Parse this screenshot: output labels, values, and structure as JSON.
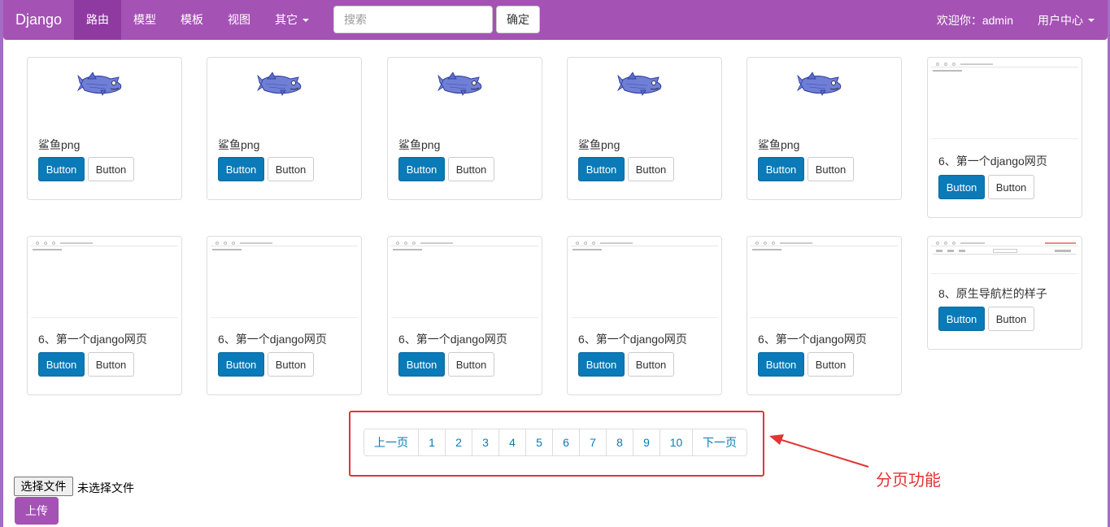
{
  "navbar": {
    "brand": "Django",
    "items": [
      {
        "label": "路由",
        "active": true
      },
      {
        "label": "模型"
      },
      {
        "label": "模板"
      },
      {
        "label": "视图"
      },
      {
        "label": "其它",
        "dropdown": true
      }
    ],
    "search_placeholder": "搜索",
    "search_button": "确定",
    "welcome": "欢迎你：admin",
    "user_center": "用户中心"
  },
  "cards": [
    {
      "caption": "鲨鱼png",
      "btn1": "Button",
      "btn2": "Button"
    },
    {
      "caption": "鲨鱼png",
      "btn1": "Button",
      "btn2": "Button"
    },
    {
      "caption": "鲨鱼png",
      "btn1": "Button",
      "btn2": "Button"
    },
    {
      "caption": "鲨鱼png",
      "btn1": "Button",
      "btn2": "Button"
    },
    {
      "caption": "鲨鱼png",
      "btn1": "Button",
      "btn2": "Button"
    },
    {
      "caption": "6、第一个django网页",
      "btn1": "Button",
      "btn2": "Button"
    },
    {
      "caption": "6、第一个django网页",
      "btn1": "Button",
      "btn2": "Button"
    },
    {
      "caption": "6、第一个django网页",
      "btn1": "Button",
      "btn2": "Button"
    },
    {
      "caption": "6、第一个django网页",
      "btn1": "Button",
      "btn2": "Button"
    },
    {
      "caption": "6、第一个django网页",
      "btn1": "Button",
      "btn2": "Button"
    },
    {
      "caption": "6、第一个django网页",
      "btn1": "Button",
      "btn2": "Button"
    },
    {
      "caption": "8、原生导航栏的样子",
      "btn1": "Button",
      "btn2": "Button"
    }
  ],
  "pagination": {
    "prev": "上一页",
    "pages": [
      "1",
      "2",
      "3",
      "4",
      "5",
      "6",
      "7",
      "8",
      "9",
      "10"
    ],
    "next": "下一页"
  },
  "annotation": {
    "label": "分页功能",
    "color": "#e53333"
  },
  "upload": {
    "file_button": "选择文件",
    "file_status": "未选择文件",
    "upload_button": "上传"
  },
  "colors": {
    "navbar": "#a452b4",
    "primary_button": "#0a7ab8"
  }
}
